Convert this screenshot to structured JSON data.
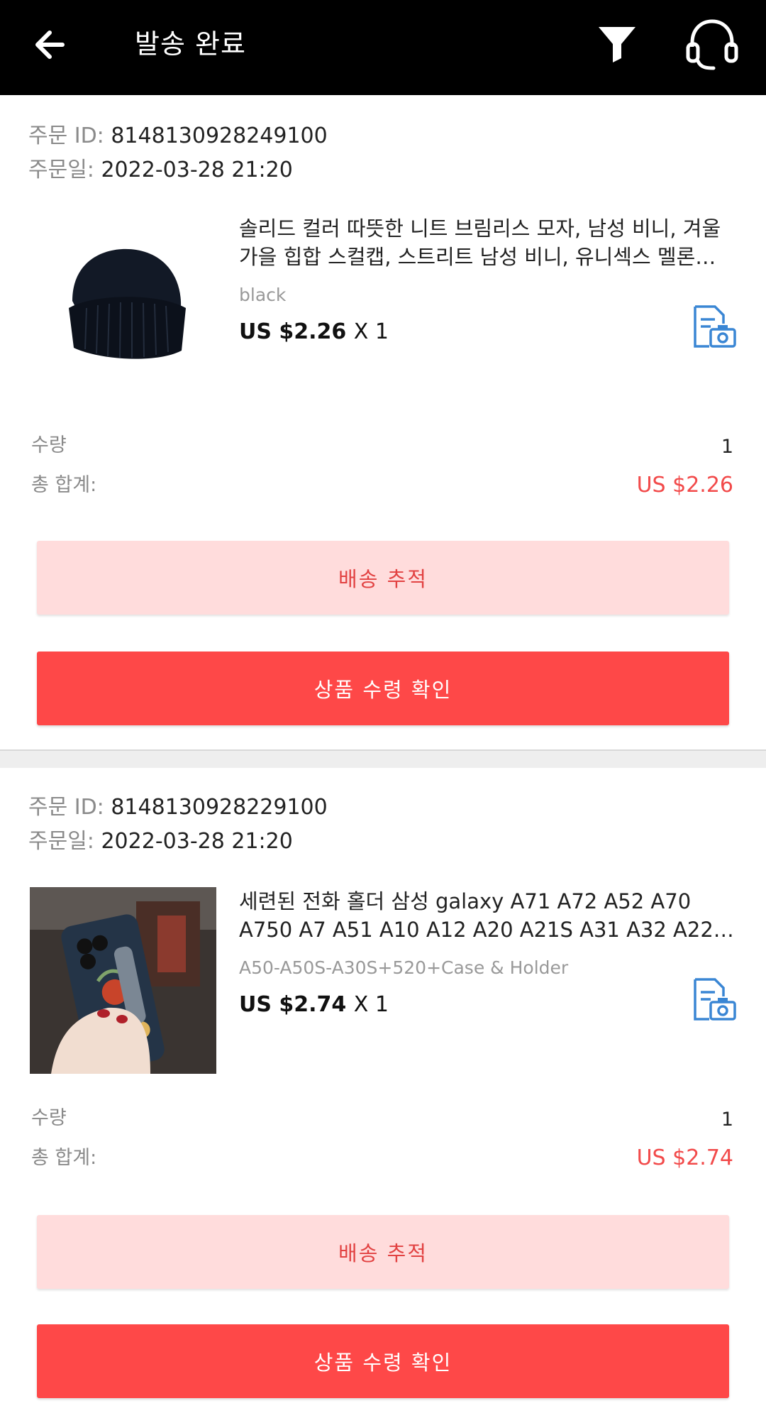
{
  "header": {
    "title": "발송 완료",
    "back_icon": "arrow-left-icon",
    "filter_icon": "filter-icon",
    "support_icon": "headset-icon"
  },
  "orders": [
    {
      "order_id_label": "주문 ID:",
      "order_id": "8148130928249100",
      "order_date_label": "주문일:",
      "order_date": "2022-03-28 21:20",
      "product_name": "솔리드 컬러 따뜻한 니트 브림리스 모자, 남성 비니, 겨울 가을 힙합 스컬캡, 스트리트 남성 비니, 유니섹스 멜론…",
      "variant": "black",
      "price": "US $2.26",
      "qty_text": "X 1",
      "quantity_label": "수량",
      "quantity": "1",
      "total_label": "총 합계:",
      "total": "US $2.26",
      "track_button": "배송 추적",
      "confirm_button": "상품 수령 확인"
    },
    {
      "order_id_label": "주문 ID:",
      "order_id": "8148130928229100",
      "order_date_label": "주문일:",
      "order_date": "2022-03-28 21:20",
      "product_name": "세련된 전화 홀더 삼성 galaxy A71 A72 A52 A70 A750 A7 A51 A10 A12 A20 A21S A31 A32 A22…",
      "variant": "A50-A50S-A30S+520+Case & Holder",
      "price": "US $2.74",
      "qty_text": "X 1",
      "quantity_label": "수량",
      "quantity": "1",
      "total_label": "총 합계:",
      "total": "US $2.74",
      "track_button": "배송 추적",
      "confirm_button": "상품 수령 확인"
    }
  ],
  "colors": {
    "accent": "#fe4848",
    "light_button": "#ffdcdc",
    "price_red": "#f24a4a",
    "icon_blue": "#3a86d4"
  }
}
